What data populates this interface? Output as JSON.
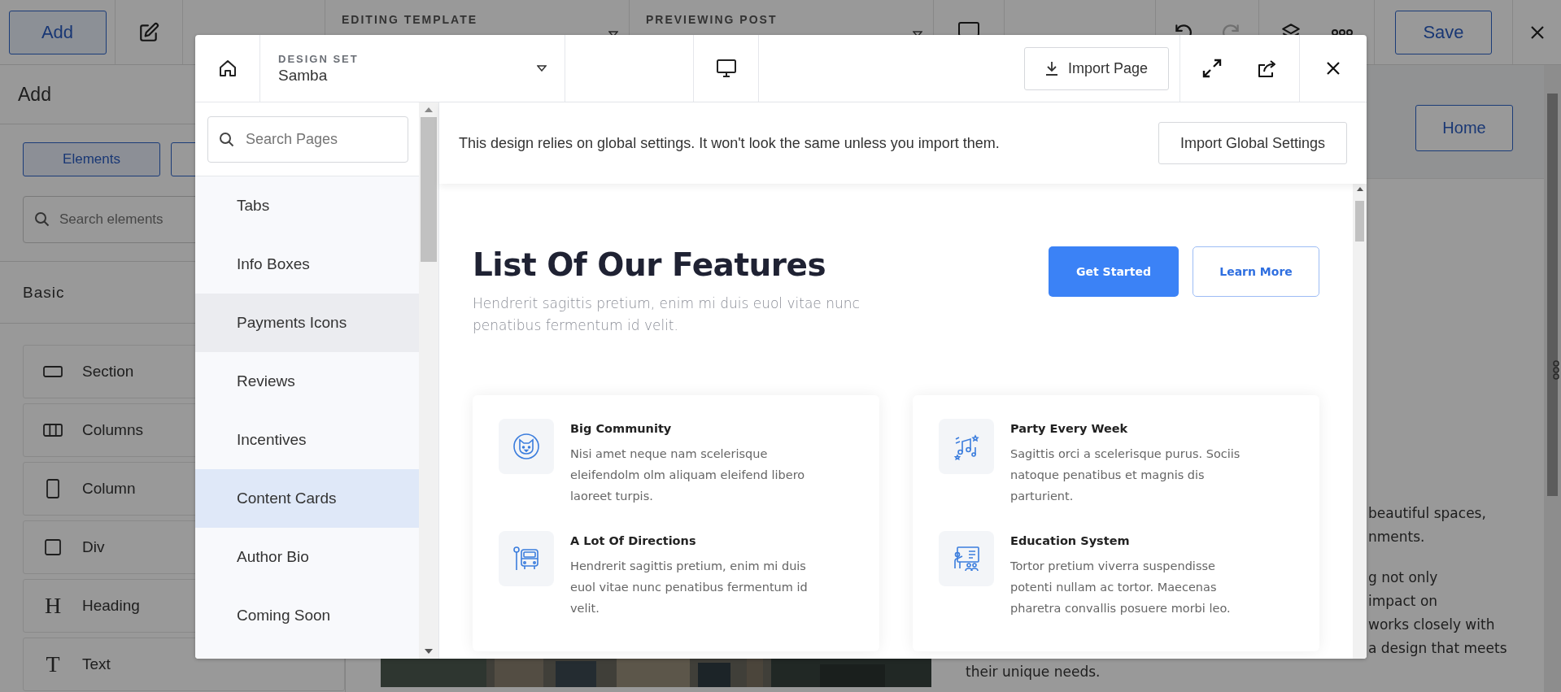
{
  "editor": {
    "toolbar": {
      "add_button": "Add",
      "editing_template_label": "EDITING TEMPLATE",
      "previewing_post_label": "PREVIEWING POST",
      "save_button": "Save"
    },
    "panel": {
      "title": "Add",
      "tab": "Elements",
      "search_placeholder": "Search elements",
      "section": "Basic",
      "elements": [
        {
          "label": "Section",
          "kind": "section"
        },
        {
          "label": "Columns",
          "kind": "columns"
        },
        {
          "label": "Column",
          "kind": "column"
        },
        {
          "label": "Div",
          "kind": "div"
        },
        {
          "label": "Heading",
          "kind": "glyph",
          "glyph": "H"
        },
        {
          "label": "Text",
          "kind": "glyph",
          "glyph": "T"
        }
      ]
    },
    "canvas": {
      "home_button": "Home",
      "paragraph_1_fragments": [
        "beautiful spaces,",
        "nments."
      ],
      "paragraph_2_fragments": [
        "g not only",
        "impact on",
        "works closely with",
        "a design that meets"
      ],
      "closing_line": "their unique needs."
    }
  },
  "modal": {
    "design_set": {
      "label": "DESIGN SET",
      "value": "Samba"
    },
    "import_page_button": "Import Page",
    "sidebar": {
      "search_placeholder": "Search Pages",
      "items": [
        {
          "label": "Tabs",
          "selected": false,
          "hovered": false
        },
        {
          "label": "Info Boxes",
          "selected": false,
          "hovered": false
        },
        {
          "label": "Payments Icons",
          "selected": false,
          "hovered": true
        },
        {
          "label": "Reviews",
          "selected": false,
          "hovered": false
        },
        {
          "label": "Incentives",
          "selected": false,
          "hovered": false
        },
        {
          "label": "Content Cards",
          "selected": true,
          "hovered": false
        },
        {
          "label": "Author Bio",
          "selected": false,
          "hovered": false
        },
        {
          "label": "Coming Soon",
          "selected": false,
          "hovered": false
        }
      ]
    },
    "notice": {
      "text": "This design relies on global settings. It won't look the same unless you import them.",
      "button": "Import Global Settings"
    },
    "preview": {
      "heading": "List Of Our Features",
      "subtitle": "Hendrerit sagittis pretium, enim mi duis euol vitae nunc penatibus fermentum id velit.",
      "buttons": [
        {
          "label": "Get Started",
          "kind": "primary"
        },
        {
          "label": "Learn More",
          "kind": "outline"
        }
      ],
      "cards": [
        {
          "features": [
            {
              "title": "Big Community",
              "description": "Nisi amet neque nam scelerisque eleifendolm olm aliquam eleifend libero laoreet turpis.",
              "kind": "cat"
            },
            {
              "title": "A Lot Of Directions",
              "description": "Hendrerit sagittis pretium, enim mi duis euol vitae nunc penatibus fermentum id velit.",
              "kind": "bus"
            }
          ]
        },
        {
          "features": [
            {
              "title": "Party Every Week",
              "description": "Sagittis orci a scelerisque purus. Sociis natoque penatibus et magnis dis parturient.",
              "kind": "music"
            },
            {
              "title": "Education System",
              "description": "Tortor pretium viverra suspendisse potenti nullam ac tortor. Maecenas pharetra convallis posuere morbi leo.",
              "kind": "teacher"
            }
          ]
        }
      ]
    }
  }
}
